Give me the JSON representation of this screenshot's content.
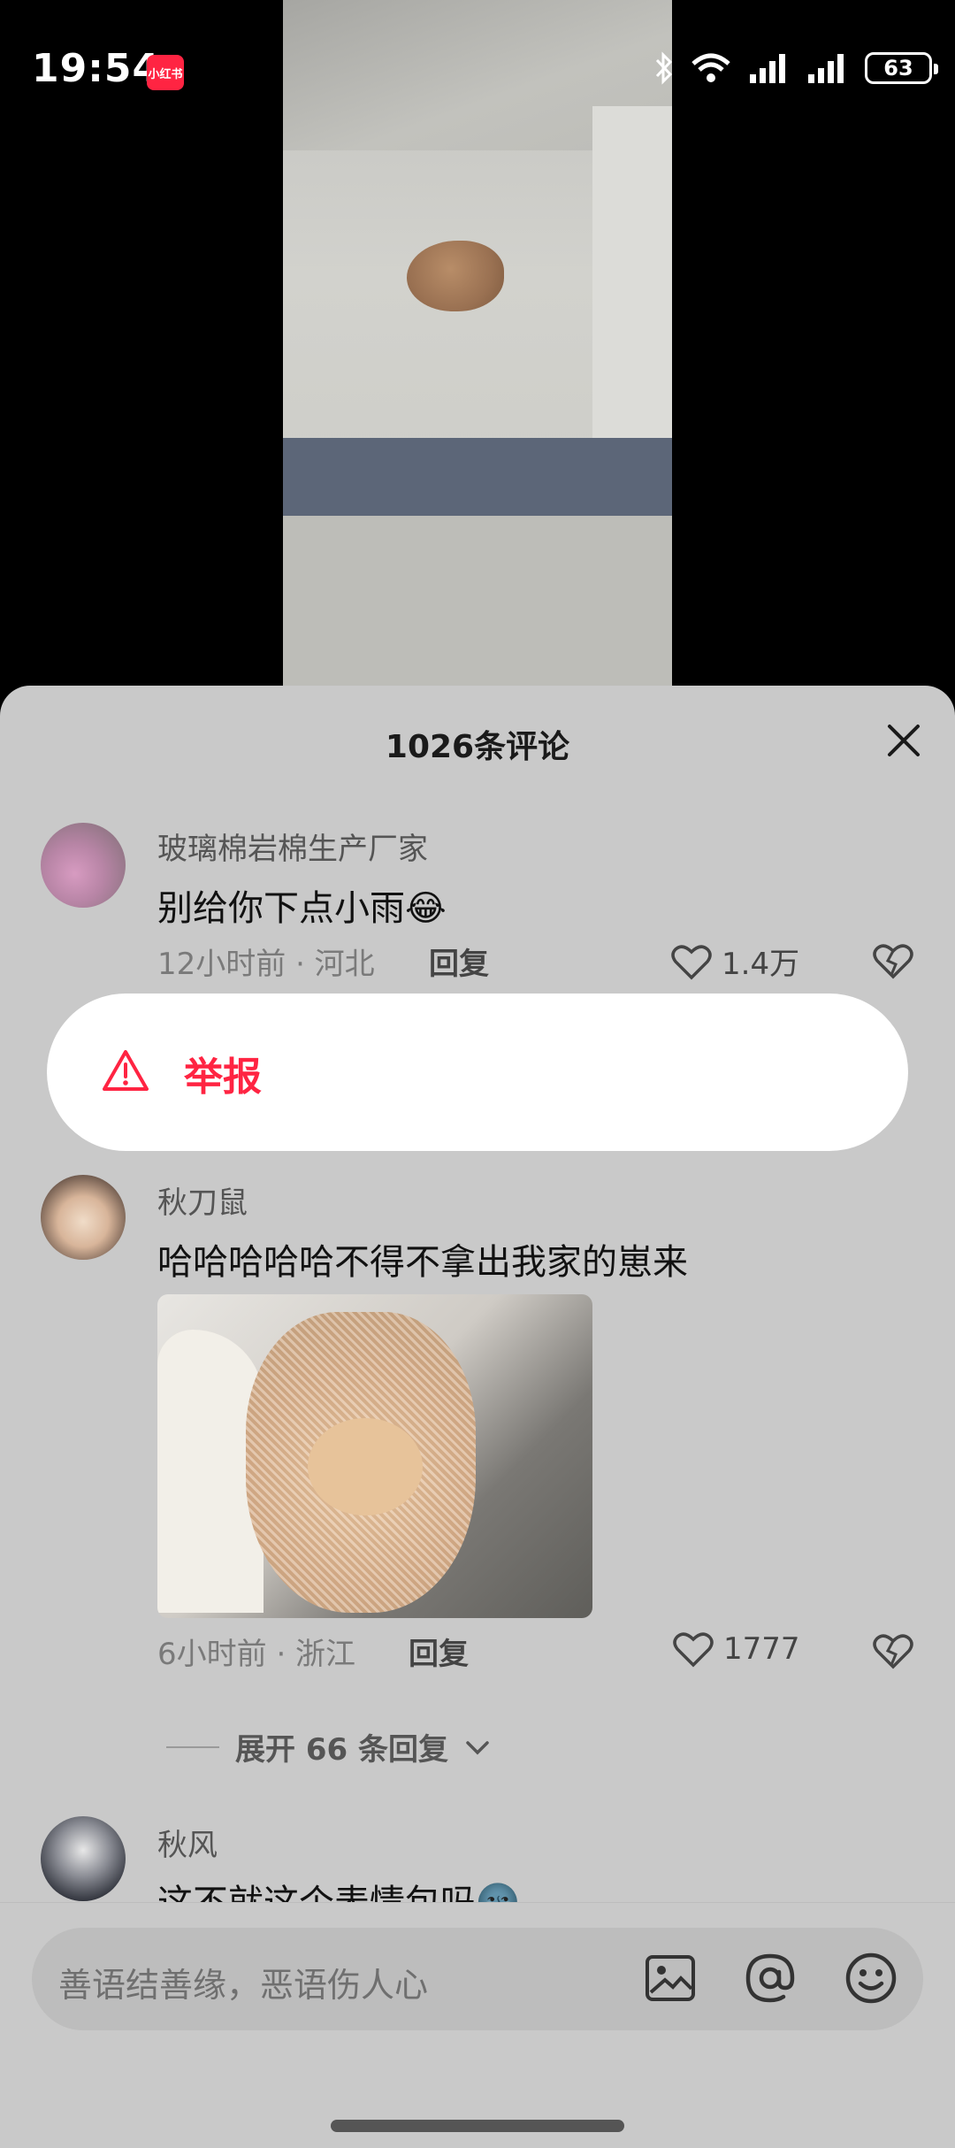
{
  "status_bar": {
    "time": "19:54",
    "app_badge": "小红书",
    "battery": "63"
  },
  "sheet": {
    "title": "1026条评论"
  },
  "comments": [
    {
      "author": "玻璃棉岩棉生产厂家",
      "text": "别给你下点小雨😂",
      "meta": "12小时前 · 河北",
      "reply_label": "回复",
      "likes": "1.4万"
    },
    {
      "author": "秋刀鼠",
      "text": "哈哈哈哈哈不得不拿出我家的崽来",
      "meta": "6小时前 · 浙江",
      "reply_label": "回复",
      "likes": "1777"
    },
    {
      "author": "秋风",
      "text": "这不就这个表情包吗🌚"
    }
  ],
  "report_menu": {
    "label": "举报",
    "accent": "#ff2442"
  },
  "expand_replies": "展开 66 条回复",
  "input": {
    "placeholder": "善语结善缘，恶语伤人心"
  },
  "icons": [
    "bluetooth-icon",
    "wifi-icon",
    "signal-icon",
    "warning-icon",
    "heart-icon",
    "broken-heart-icon",
    "image-icon",
    "at-icon",
    "emoji-icon",
    "close-icon",
    "chevron-down-icon"
  ]
}
